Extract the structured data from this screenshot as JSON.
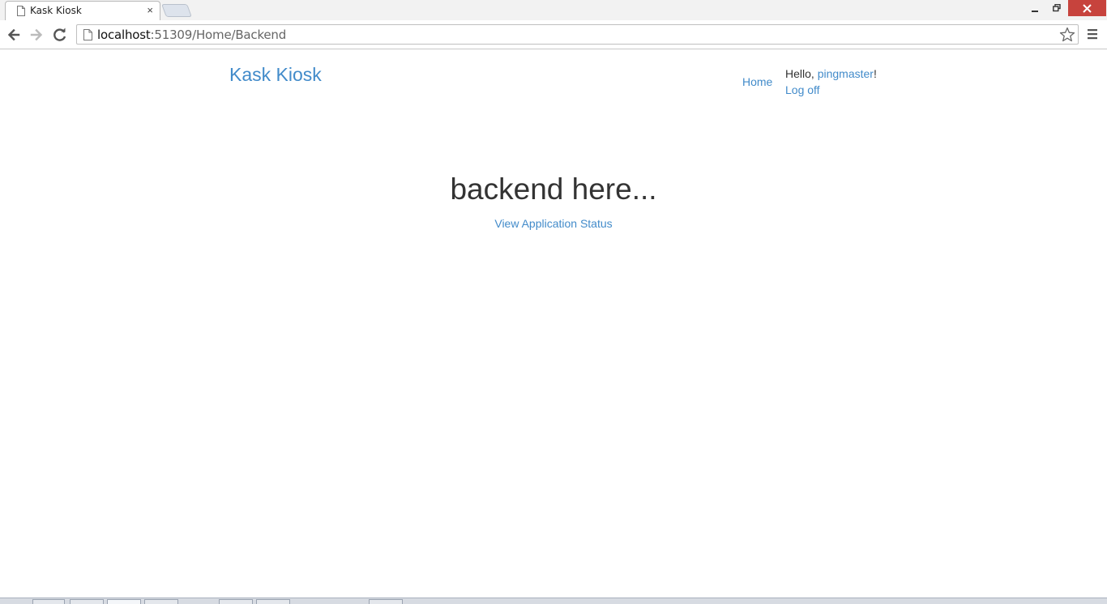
{
  "browser": {
    "tab_title": "Kask Kiosk",
    "tab_close": "×",
    "url_host": "localhost",
    "url_rest": ":51309/Home/Backend",
    "win_min": "‒",
    "win_max": "❐",
    "win_close": "✕"
  },
  "navbar": {
    "brand": "Kask Kiosk",
    "home_link": "Home",
    "greeting_prefix": "Hello, ",
    "username": "pingmaster",
    "greeting_suffix": "!",
    "logoff_link": "Log off"
  },
  "main": {
    "heading": "backend here...",
    "status_link": "View Application Status"
  }
}
